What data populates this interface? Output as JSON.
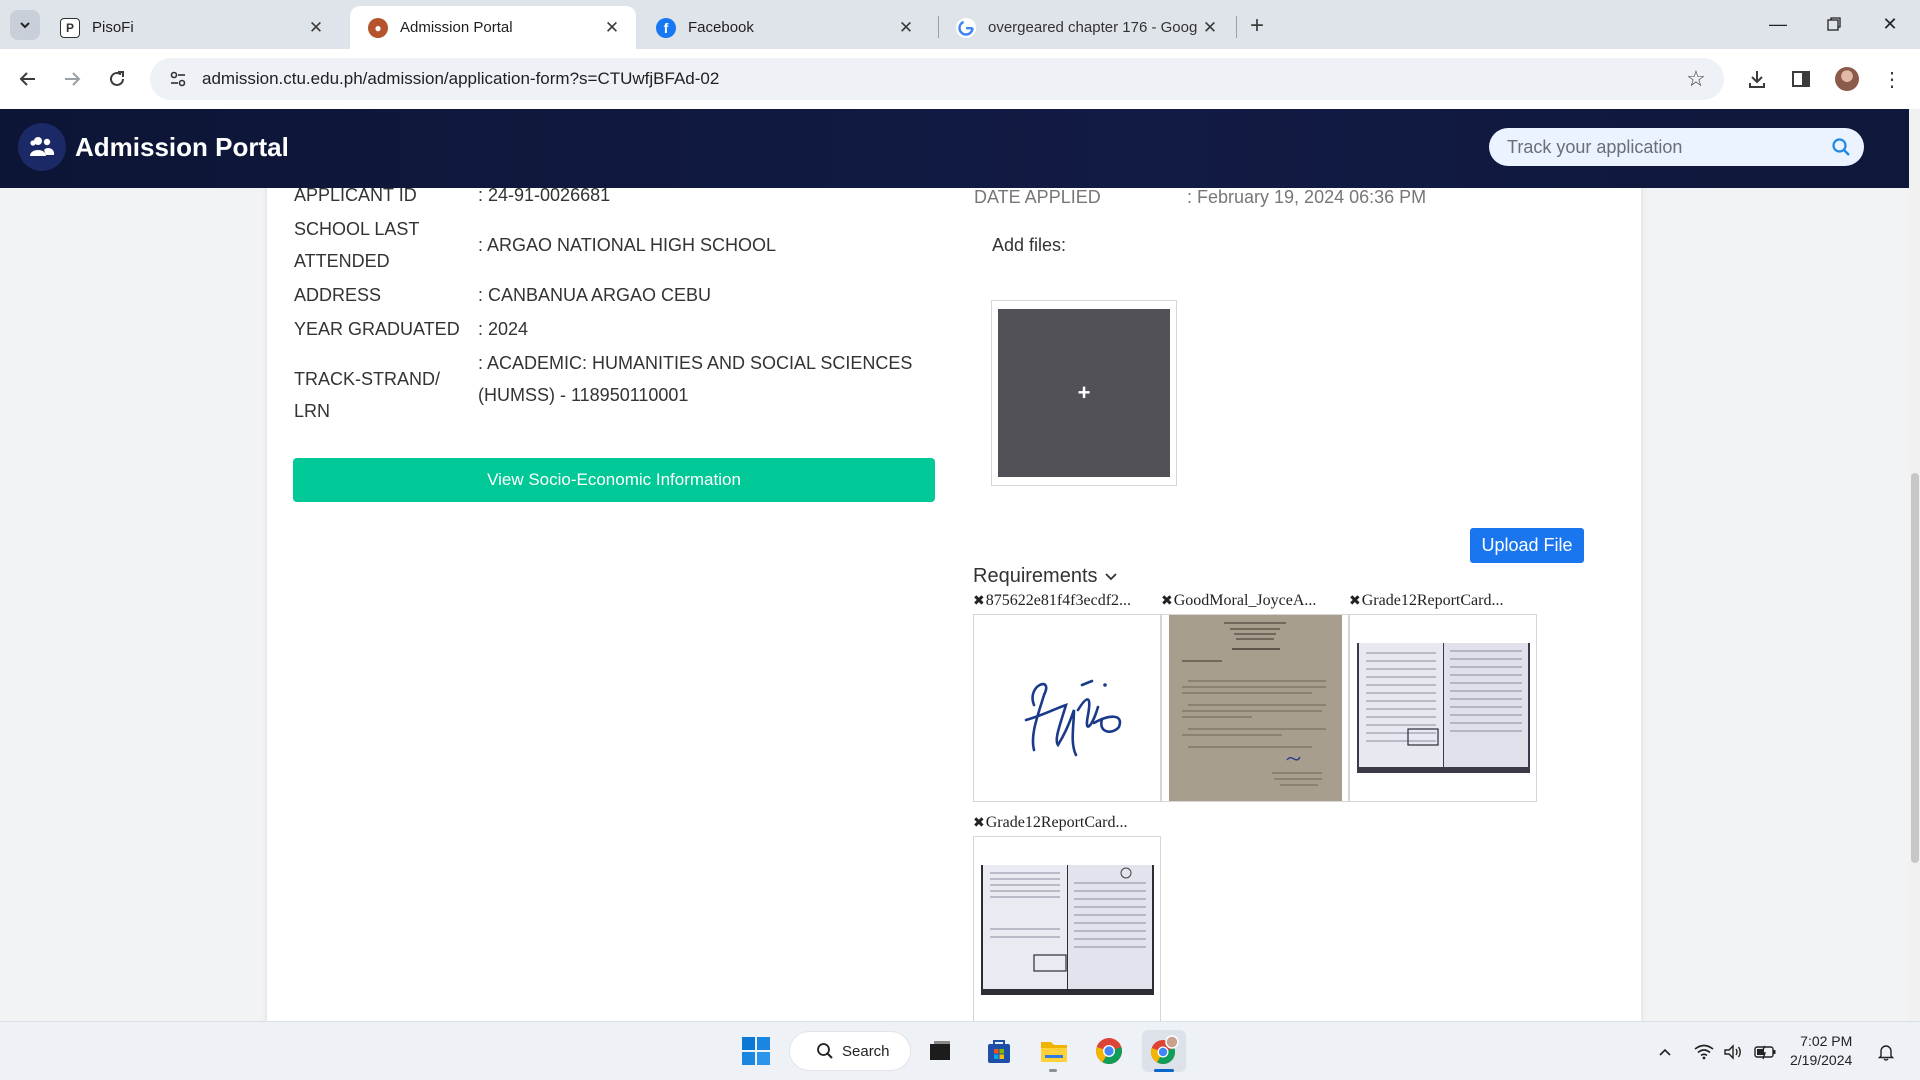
{
  "browser": {
    "tabs": [
      {
        "title": "PisoFi",
        "active": false
      },
      {
        "title": "Admission Portal",
        "active": true
      },
      {
        "title": "Facebook",
        "active": false
      },
      {
        "title": "overgeared chapter 176 - Goog",
        "active": false
      }
    ],
    "url": "admission.ctu.edu.ph/admission/application-form?s=CTUwfjBFAd-02"
  },
  "portal": {
    "brand": "Admission Portal",
    "track_placeholder": "Track your application"
  },
  "applicant": {
    "date_applied_label": "DATE APPLIED",
    "date_applied_value": ": February 19, 2024 06:36 PM",
    "rows": [
      {
        "label": "APPLICANT ID",
        "value": ": 24-91-0026681"
      },
      {
        "label": "SCHOOL LAST ATTENDED",
        "value": ": ARGAO NATIONAL HIGH SCHOOL"
      },
      {
        "label": "ADDRESS",
        "value": ": CANBANUA ARGAO CEBU"
      },
      {
        "label": "YEAR GRADUATED",
        "value": ": 2024"
      },
      {
        "label": "TRACK-STRAND/ LRN",
        "value": ": ACADEMIC: HUMANITIES AND SOCIAL SCIENCES (HUMSS) - 118950110001"
      }
    ],
    "socio_button": "View Socio-Economic Information"
  },
  "files": {
    "add_files_label": "Add files:",
    "dropzone_symbol": "+",
    "upload_button": "Upload File",
    "requirements_label": "Requirements",
    "remove_symbol": "✖",
    "items": [
      {
        "name": "875622e81f4f3ecdf2..."
      },
      {
        "name": "GoodMoral_JoyceA..."
      },
      {
        "name": "Grade12ReportCard..."
      },
      {
        "name": "Grade12ReportCard..."
      }
    ]
  },
  "taskbar": {
    "search_label": "Search",
    "time": "7:02 PM",
    "date": "2/19/2024"
  }
}
